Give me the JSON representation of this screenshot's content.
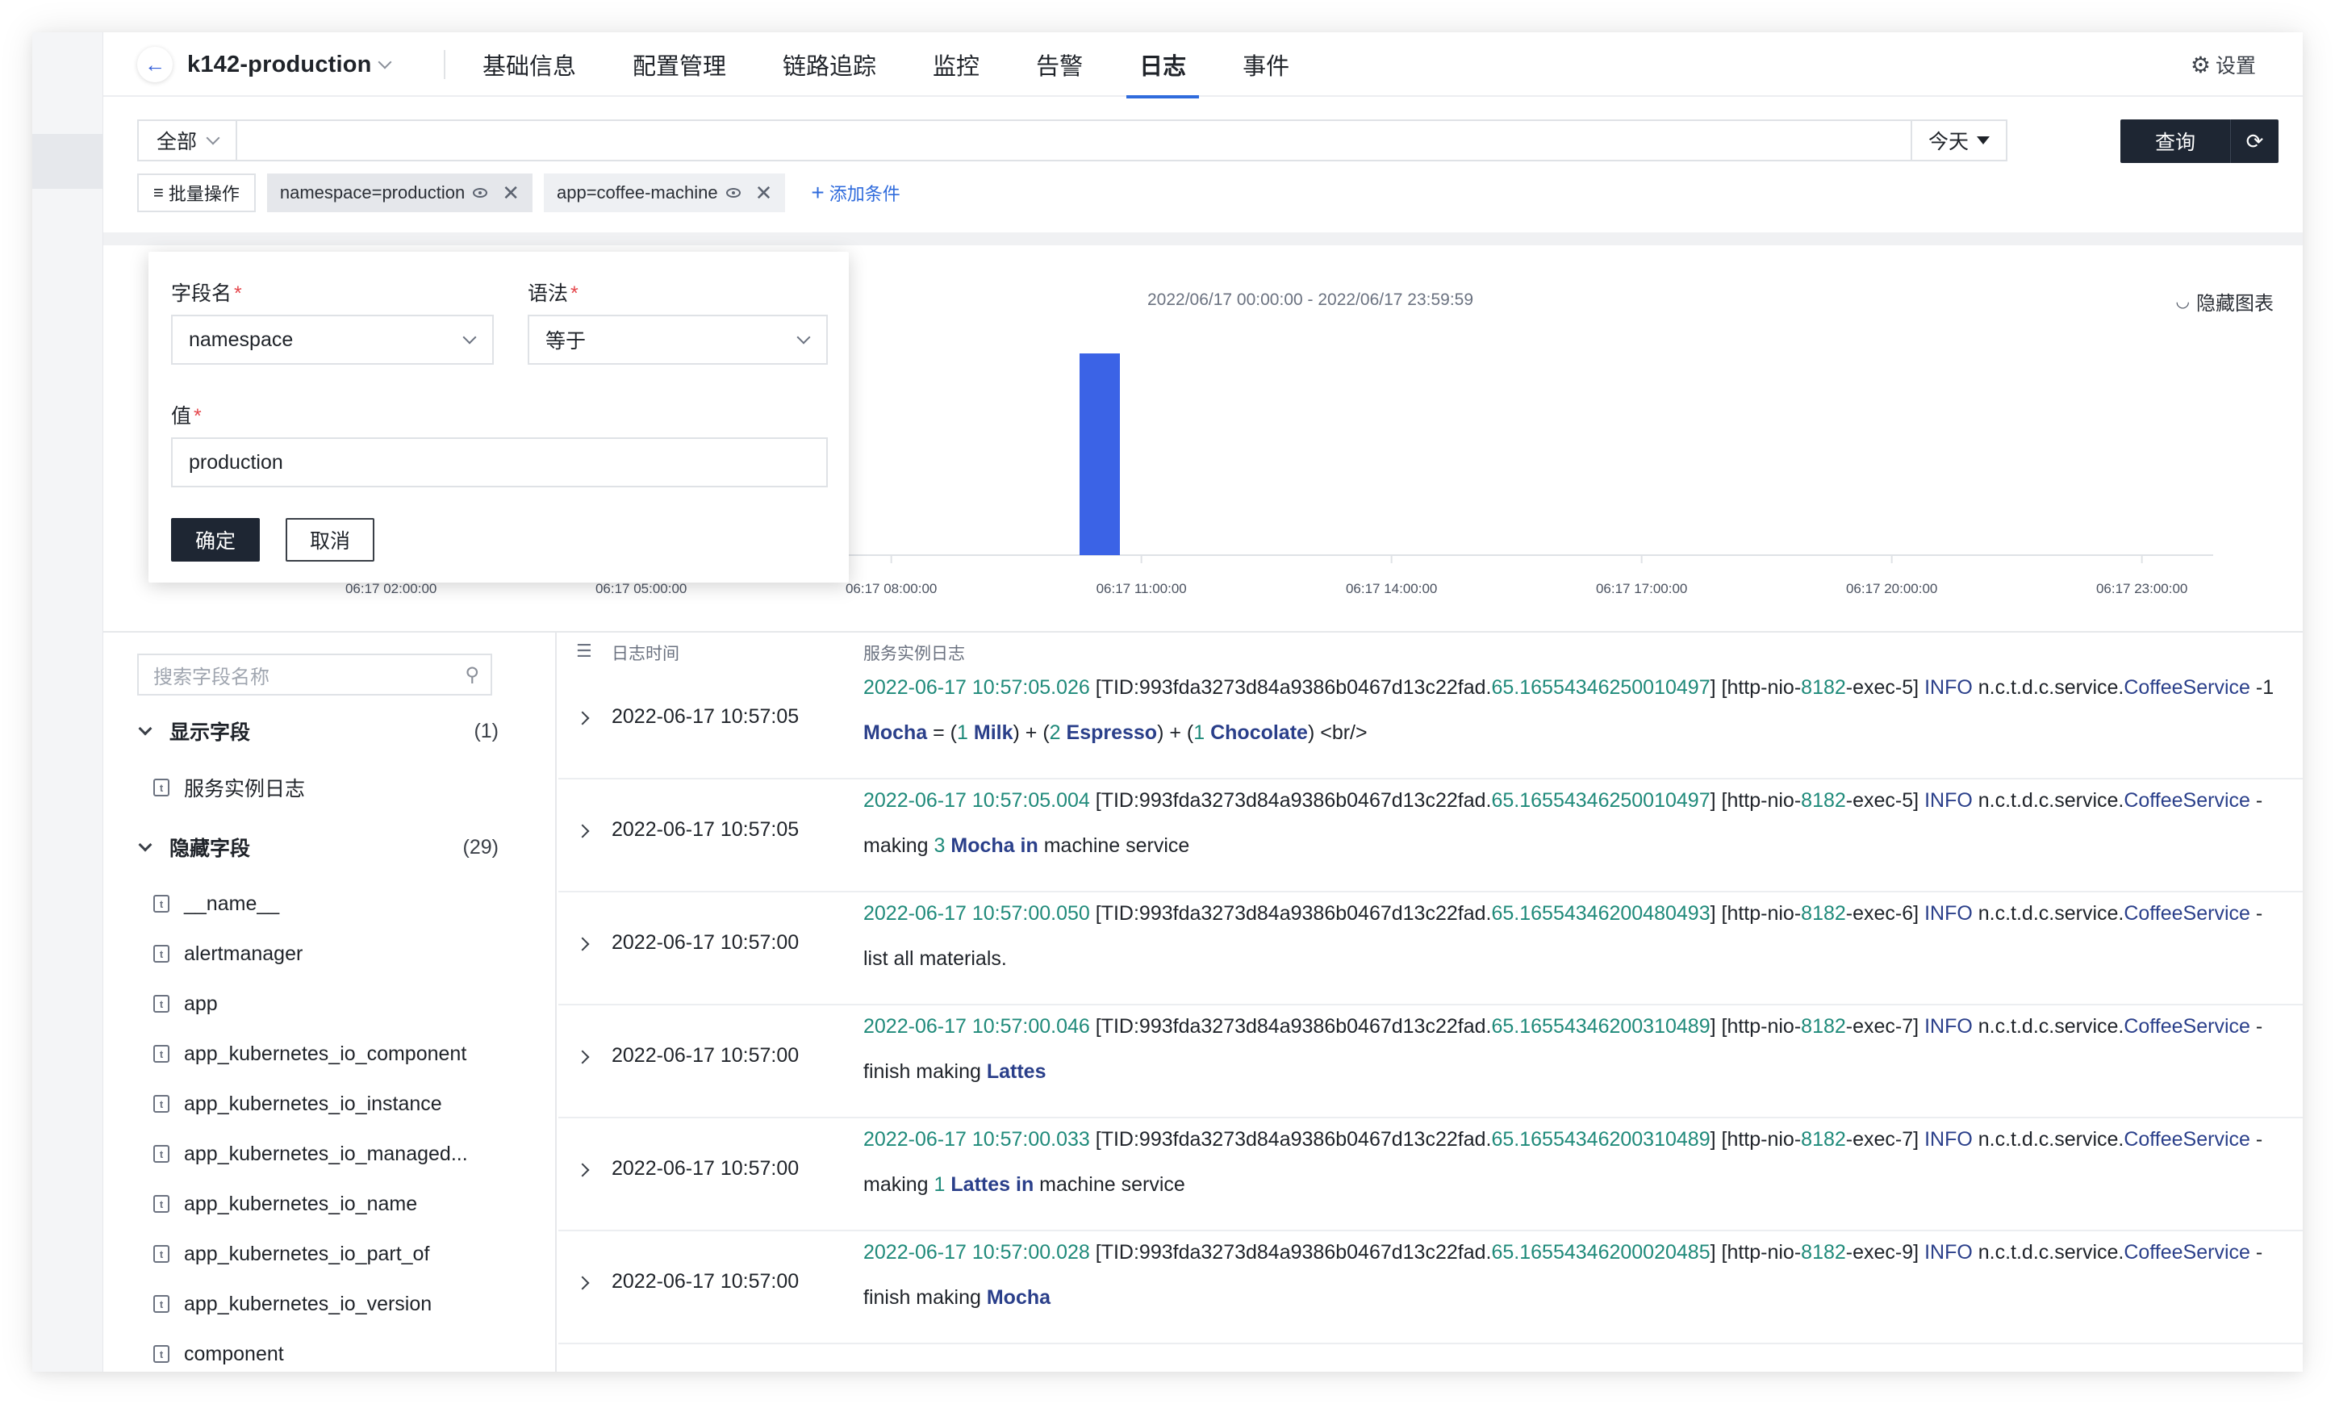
{
  "nav": {
    "back_icon": "arrow-left-icon",
    "cluster": "k142-production",
    "tabs": [
      "基础信息",
      "配置管理",
      "链路追踪",
      "监控",
      "告警",
      "日志",
      "事件"
    ],
    "active_tab": "日志",
    "settings": "设置"
  },
  "search": {
    "scope": "全部",
    "query": "",
    "time_range": "今天",
    "query_button": "查询"
  },
  "filters": {
    "batch": "批量操作",
    "chips": [
      "namespace=production",
      "app=coffee-machine"
    ],
    "add_condition": "添加条件"
  },
  "chart": {
    "range": "2022/06/17 00:00:00 - 2022/06/17 23:59:59",
    "hide_label": "隐藏图表"
  },
  "chart_data": {
    "type": "bar",
    "x_ticks": [
      "06:17 02:00:00",
      "06:17 05:00:00",
      "06:17 08:00:00",
      "06:17 11:00:00",
      "06:17 14:00:00",
      "06:17 17:00:00",
      "06:17 20:00:00",
      "06:17 23:00:00"
    ],
    "y_ticks": [
      "0"
    ],
    "bars": [
      {
        "x": "06:17 10:30:00",
        "value": 1
      }
    ],
    "color": "#3b63e6"
  },
  "popover": {
    "field_label": "字段名",
    "syntax_label": "语法",
    "value_label": "值",
    "field_value": "namespace",
    "syntax_value": "等于",
    "value": "production",
    "ok": "确定",
    "cancel": "取消"
  },
  "fields": {
    "search_placeholder": "搜索字段名称",
    "shown_group": "显示字段",
    "shown_count": "(1)",
    "shown": [
      "服务实例日志"
    ],
    "hidden_group": "隐藏字段",
    "hidden_count": "(29)",
    "hidden": [
      "__name__",
      "alertmanager",
      "app",
      "app_kubernetes_io_component",
      "app_kubernetes_io_instance",
      "app_kubernetes_io_managed...",
      "app_kubernetes_io_name",
      "app_kubernetes_io_part_of",
      "app_kubernetes_io_version",
      "component"
    ]
  },
  "logs": {
    "col_time": "日志时间",
    "col_log": "服务实例日志",
    "rows": [
      {
        "time": "2022-06-17 10:57:05",
        "ts": "2022-06-17 10:57:05.026",
        "tid": "993fda3273d84a9386b0467d13c22fad",
        "span": "65.16554346250010497",
        "port": "8182",
        "exec": "5",
        "svc": "CoffeeService",
        "msg_parts": [
          "Mocha",
          " = (",
          "1",
          " ",
          "Milk",
          ") + (",
          "2",
          " ",
          "Espresso",
          ") + (",
          "1",
          " ",
          "Chocolate",
          ") <br/>"
        ],
        "trail": "-1"
      },
      {
        "time": "2022-06-17 10:57:05",
        "ts": "2022-06-17 10:57:05.004",
        "tid": "993fda3273d84a9386b0467d13c22fad",
        "span": "65.16554346250010497",
        "port": "8182",
        "exec": "5",
        "svc": "CoffeeService",
        "msg_parts": [
          "making ",
          "3",
          " ",
          "Mocha",
          " ",
          "in",
          " machine service"
        ],
        "trail": "-"
      },
      {
        "time": "2022-06-17 10:57:00",
        "ts": "2022-06-17 10:57:00.050",
        "tid": "993fda3273d84a9386b0467d13c22fad",
        "span": "65.16554346200480493",
        "port": "8182",
        "exec": "6",
        "svc": "CoffeeService",
        "msg_parts": [
          "list all materials."
        ],
        "trail": "-"
      },
      {
        "time": "2022-06-17 10:57:00",
        "ts": "2022-06-17 10:57:00.046",
        "tid": "993fda3273d84a9386b0467d13c22fad",
        "span": "65.16554346200310489",
        "port": "8182",
        "exec": "7",
        "svc": "CoffeeService",
        "msg_parts": [
          "finish making ",
          "Lattes"
        ],
        "trail": "-"
      },
      {
        "time": "2022-06-17 10:57:00",
        "ts": "2022-06-17 10:57:00.033",
        "tid": "993fda3273d84a9386b0467d13c22fad",
        "span": "65.16554346200310489",
        "port": "8182",
        "exec": "7",
        "svc": "CoffeeService",
        "msg_parts": [
          "making ",
          "1",
          " ",
          "Lattes",
          " ",
          "in",
          " machine service"
        ],
        "trail": "-"
      },
      {
        "time": "2022-06-17 10:57:00",
        "ts": "2022-06-17 10:57:00.028",
        "tid": "993fda3273d84a9386b0467d13c22fad",
        "span": "65.16554346200020485",
        "port": "8182",
        "exec": "9",
        "svc": "CoffeeService",
        "msg_parts": [
          "finish making ",
          "Mocha"
        ],
        "trail": "-"
      }
    ]
  },
  "log_text": {
    "tid_prefix": "[TID:",
    "thread_prefix": "] [http-nio-",
    "exec_prefix": "-exec-",
    "level": "INFO",
    "pkg": " n.c.t.d.c.service.",
    "close": "] "
  },
  "colors": {
    "accent": "#2f6bdc",
    "dark_button": "#1e2633",
    "log_green": "#1f8a7a",
    "log_navy": "#2a3f8a",
    "required": "#e5484d"
  }
}
